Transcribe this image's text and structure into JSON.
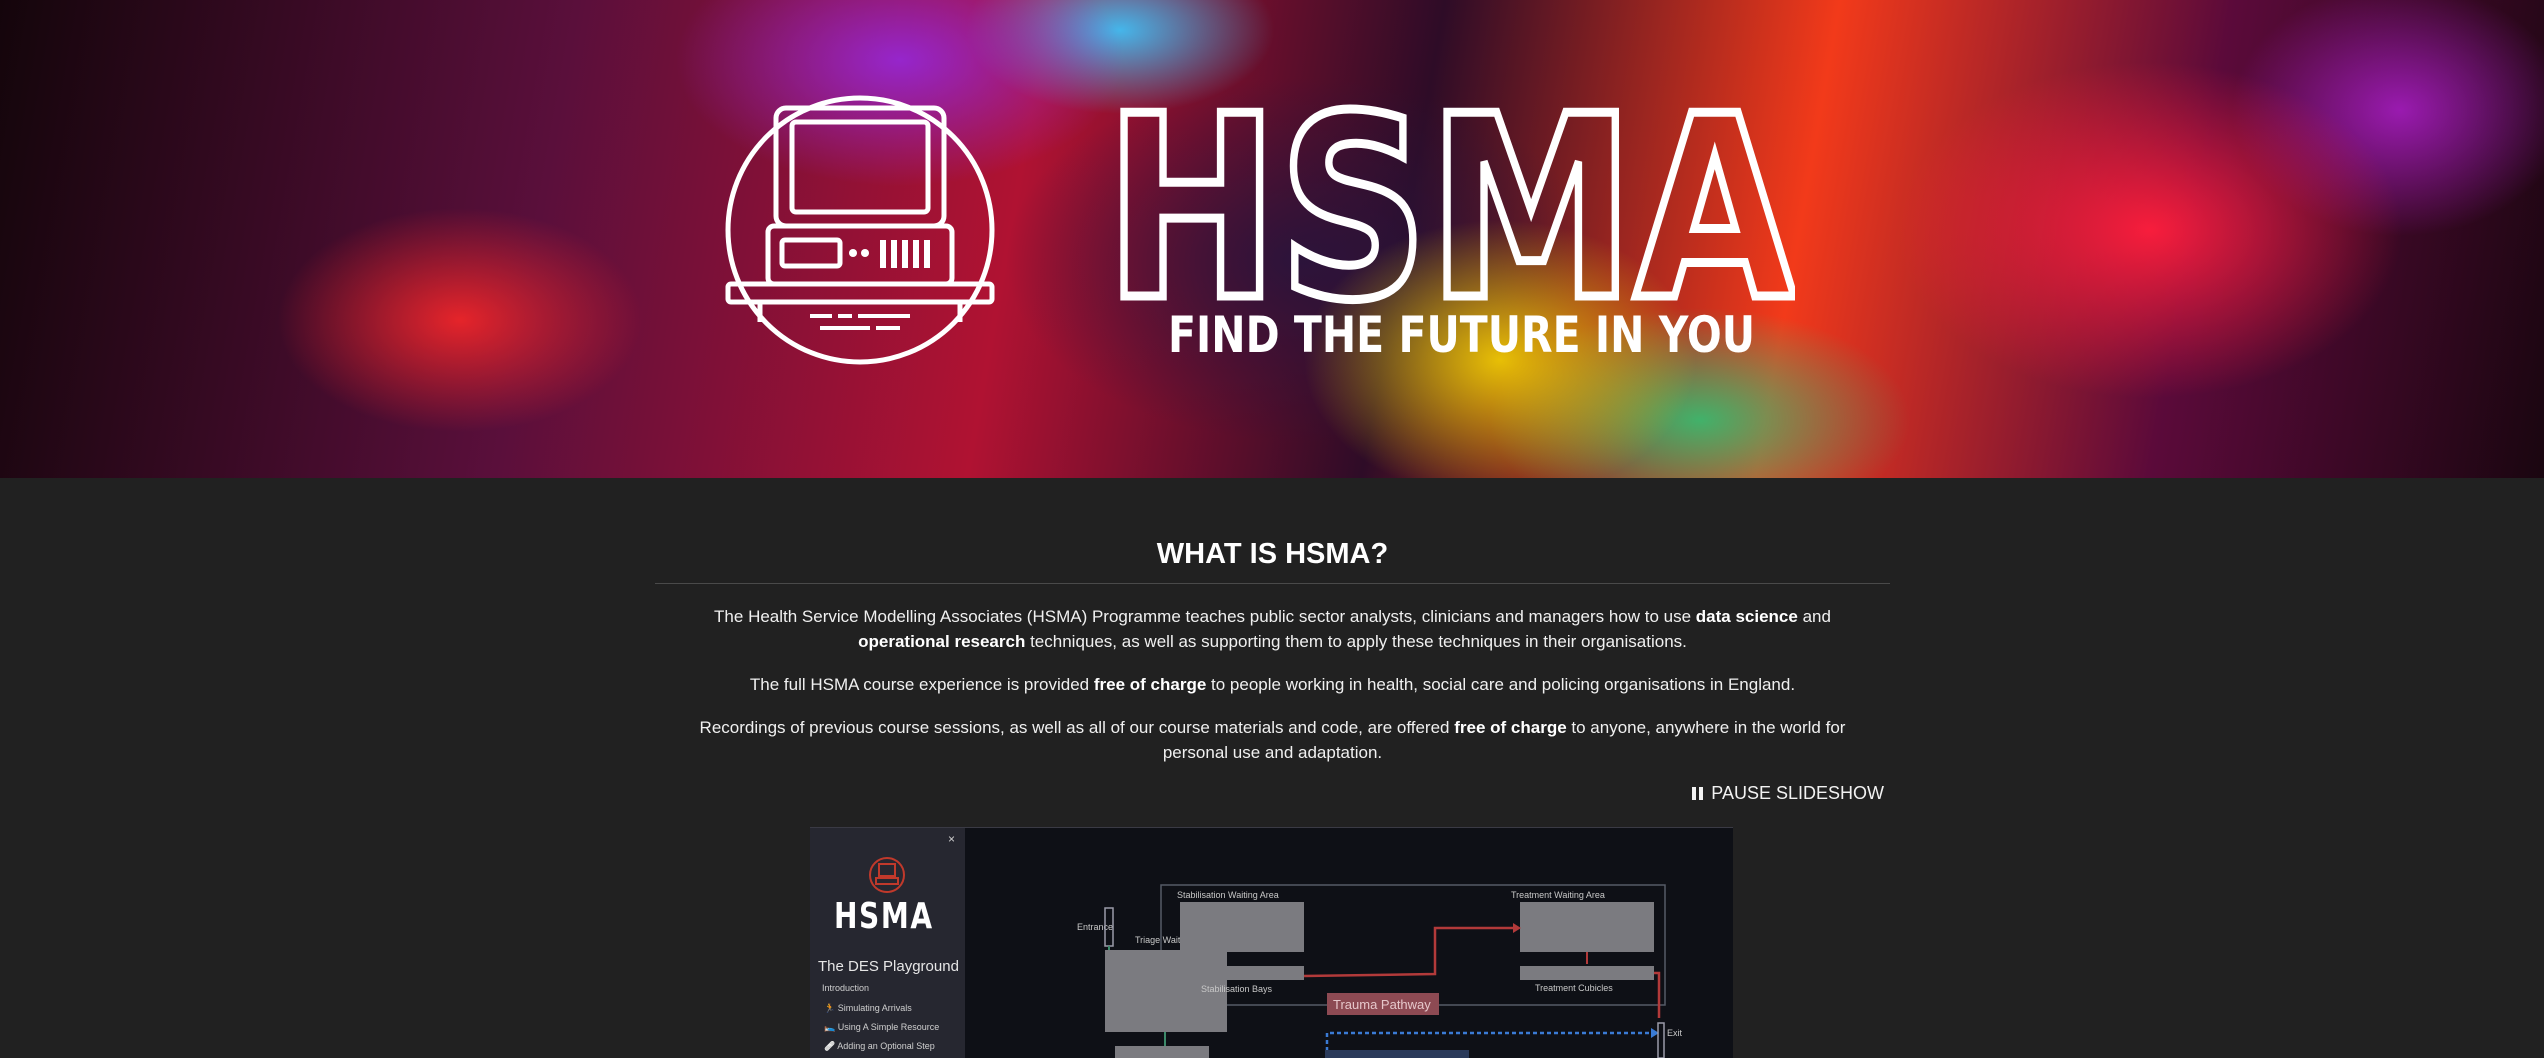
{
  "hero": {
    "brand": "HSMA",
    "tagline": "FIND THE FUTURE IN YOU",
    "logo_icon": "retro-computer-icon"
  },
  "about": {
    "heading": "WHAT IS HSMA?",
    "p1": {
      "t1": "The Health Service Modelling Associates (HSMA) Programme teaches public sector analysts, clinicians and managers how to use ",
      "b1": "data science",
      "t2": " and ",
      "b2": "operational research",
      "t3": " techniques, as well as supporting them to apply these techniques in their organisations."
    },
    "p2": {
      "t1": "The full HSMA course experience is provided ",
      "b1": "free of charge",
      "t2": " to people working in health, social care and policing organisations in England."
    },
    "p3": {
      "t1": "Recordings of previous course sessions, as well as all of our course materials and code, are offered ",
      "b1": "free of charge",
      "t2": " to anyone, anywhere in the world for personal use and adaptation."
    },
    "pause_label": "PAUSE SLIDESHOW"
  },
  "slide": {
    "sidebar": {
      "close": "×",
      "brand": "HSMA",
      "title": "The DES Playground",
      "intro": "Introduction",
      "items": [
        "Simulating Arrivals",
        "Using A Simple Resource",
        "Adding an Optional Step"
      ]
    },
    "diagram": {
      "entrance": "Entrance",
      "triage_waiting_room": "Triage Waiting Room",
      "stabilisation_waiting_area": "Stabilisation Waiting Area",
      "stabilisation_bays": "Stabilisation Bays",
      "treatment_waiting_area": "Treatment Waiting Area",
      "treatment_cubicles": "Treatment Cubicles",
      "trauma_pathway": "Trauma Pathway",
      "exit": "Exit"
    }
  }
}
